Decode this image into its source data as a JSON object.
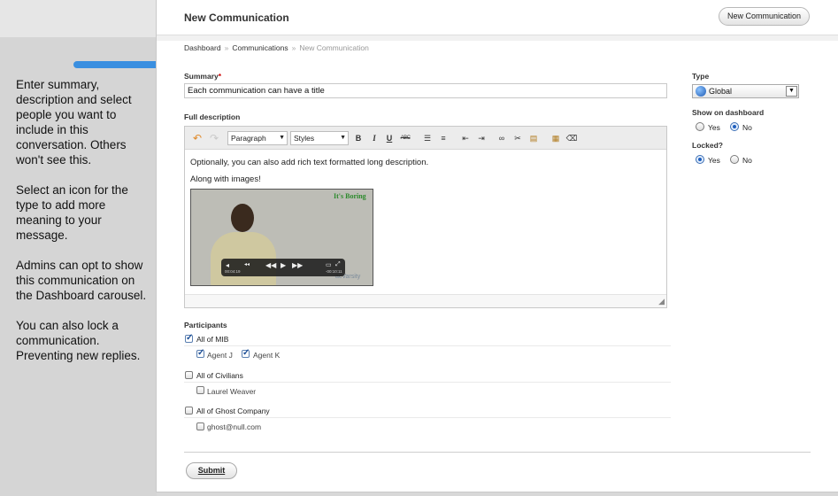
{
  "sidebar": {
    "notes": [
      "Enter summary, description and select people you want to include in this conversation. Others won't see this.",
      "Select an icon for the type to add more meaning to your message.",
      "Admins can opt to show this communication on the Dashboard carousel.",
      "You can also lock a communication. Preventing new replies."
    ]
  },
  "header": {
    "title": "New Communication",
    "new_button": "New Communication"
  },
  "breadcrumb": {
    "items": [
      "Dashboard",
      "Communications",
      "New Communication"
    ],
    "separator": "»"
  },
  "form": {
    "summary_label": "Summary",
    "required_mark": "*",
    "summary_value": "Each communication can have a title",
    "description_label": "Full description",
    "toolbar": {
      "format_select": "Paragraph",
      "styles_select": "Styles",
      "bold": "B",
      "italic": "I",
      "underline": "U",
      "strike": "ABC"
    },
    "editor_lines": [
      "Optionally, you can also add rich text formatted long description.",
      "Along with images!"
    ],
    "video": {
      "tag": "It's Boring",
      "brand": "acVarsity",
      "time_left": "00:04:19",
      "time_right": "-00:10:11"
    },
    "participants_label": "Participants",
    "groups": [
      {
        "name": "All of MIB",
        "checked": true,
        "members": [
          {
            "name": "Agent J",
            "checked": true
          },
          {
            "name": "Agent K",
            "checked": true
          }
        ]
      },
      {
        "name": "All of Civilians",
        "checked": false,
        "members": [
          {
            "name": "Laurel Weaver",
            "checked": false
          }
        ]
      },
      {
        "name": "All of Ghost Company",
        "checked": false,
        "members": [
          {
            "name": "ghost@null.com",
            "checked": false
          }
        ]
      }
    ],
    "submit_label": "Submit"
  },
  "options": {
    "type_label": "Type",
    "type_value": "Global",
    "type_icon": "globe-icon",
    "dashboard_label": "Show on dashboard",
    "dashboard_selected": "No",
    "locked_label": "Locked?",
    "locked_selected": "Yes",
    "yes": "Yes",
    "no": "No"
  },
  "colors": {
    "accent_pointer": "#3a8fe0",
    "required": "#cc0000",
    "video_tag": "#2c8a2c"
  }
}
